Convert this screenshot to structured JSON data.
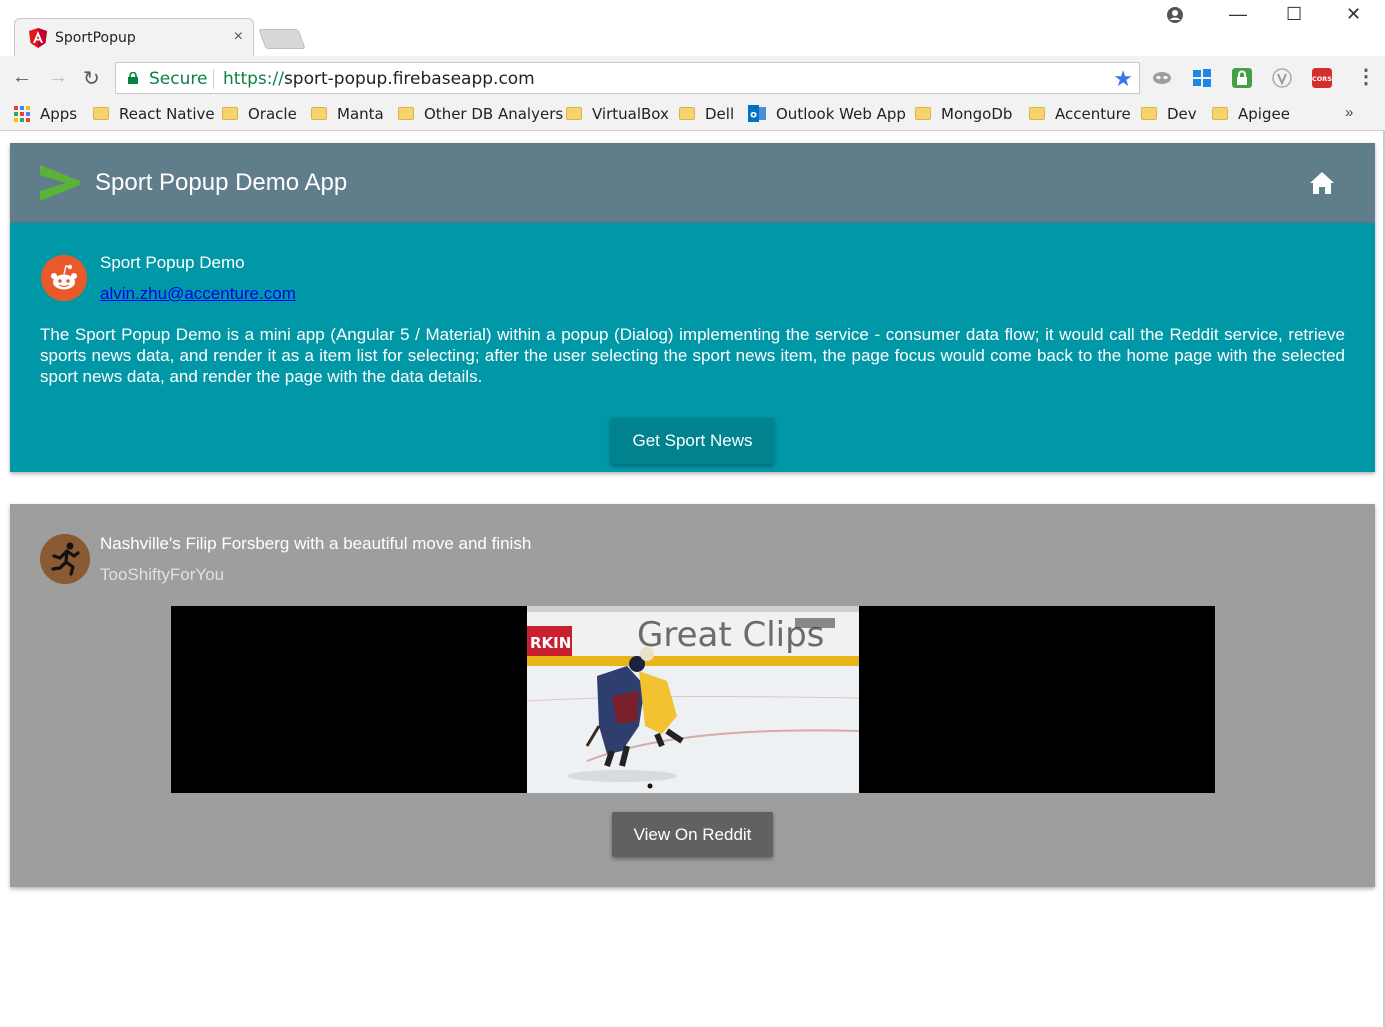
{
  "browser": {
    "tab_title": "SportPopup",
    "tab_close": "×",
    "nav": {
      "back": "←",
      "forward": "→",
      "reload": "↻"
    },
    "secure_label": "Secure",
    "url_scheme": "https://",
    "url_host": "sport-popup.firebaseapp.com",
    "bookmark_star": "★",
    "menu": "⋮",
    "window_controls": {
      "account": "●",
      "minimize": "—",
      "maximize": "☐",
      "close": "✕"
    },
    "extensions": [
      {
        "name": "mask-ext-icon",
        "color": "#9e9e9e"
      },
      {
        "name": "windows-ext-icon",
        "color": "#1e88e5"
      },
      {
        "name": "lock-ext-icon",
        "color": "#43a047"
      },
      {
        "name": "v-ext-icon",
        "color": "#bdbdbd"
      },
      {
        "name": "cors-ext-icon",
        "color": "#d32f2f",
        "label": "CORS"
      }
    ],
    "bookmarks": {
      "apps": "Apps",
      "items": [
        "React Native",
        "Oracle",
        "Manta",
        "Other DB Analyers",
        "VirtualBox",
        "Dell",
        "Outlook Web App",
        "MongoDb",
        "Accenture",
        "Dev",
        "Apigee"
      ],
      "more": "»"
    }
  },
  "appbar": {
    "title": "Sport Popup Demo App",
    "color": "#607d8b"
  },
  "intro_card": {
    "title": "Sport Popup Demo",
    "email": "alvin.zhu@accenture.com",
    "description": "The Sport Popup Demo is a mini app (Angular 5 / Material) within a popup (Dialog) implementing the service - consumer data flow; it would call the Reddit service, retrieve sports news data, and render it as a item list for selecting; after the user selecting the sport news item, the page focus would come back to the home page with the selected sport news data, and render the page with the data details.",
    "button": "Get Sport News",
    "color": "#0097a7"
  },
  "news_card": {
    "title": "Nashville's Filip Forsberg with a beautiful move and finish",
    "author": "TooShiftyForYou",
    "video_sign": "Great Clips",
    "video_board": "RKIN",
    "button": "View On Reddit",
    "color": "#9e9e9e"
  }
}
